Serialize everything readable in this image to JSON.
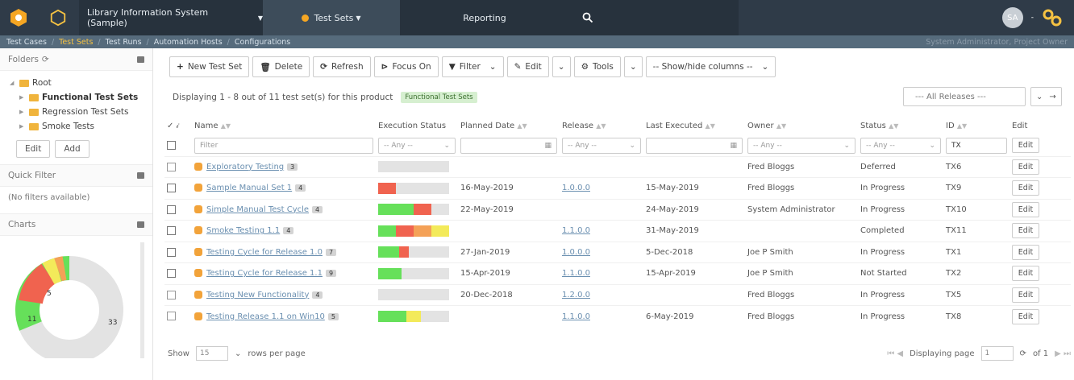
{
  "topnav": {
    "project": "Library Information System (Sample)",
    "test_sets_menu": "Test Sets",
    "reporting": "Reporting",
    "avatar_initials": "SA",
    "accent_color": "#f5a623"
  },
  "subnav": {
    "items": [
      "Test Cases",
      "Test Sets",
      "Test Runs",
      "Automation Hosts",
      "Configurations"
    ],
    "right_text": "System Administrator, Project Owner"
  },
  "sidebar": {
    "folders_title": "Folders",
    "tree": {
      "root": "Root",
      "children": [
        "Functional Test Sets",
        "Regression Test Sets",
        "Smoke Tests"
      ]
    },
    "edit_label": "Edit",
    "add_label": "Add",
    "quick_filter_title": "Quick Filter",
    "no_filters": "(No filters available)",
    "charts_title": "Charts",
    "chart": {
      "labels": [
        "5",
        "11",
        "33"
      ]
    }
  },
  "toolbar": {
    "new_test_set": "New Test Set",
    "delete": "Delete",
    "refresh": "Refresh",
    "focus_on": "Focus On",
    "filter": "Filter",
    "edit": "Edit",
    "tools": "Tools",
    "show_hide": "-- Show/hide columns --"
  },
  "summary": {
    "displaying": "Displaying 1 - 8 out of 11 test set(s) for this product",
    "folder_badge": "Functional Test Sets",
    "releases_select": "--- All Releases ---"
  },
  "columns": [
    "Name",
    "Execution Status",
    "Planned Date",
    "Release",
    "Last Executed",
    "Owner",
    "Status",
    "ID",
    "Edit"
  ],
  "filters": {
    "name_placeholder": "Filter",
    "any": "-- Any --",
    "id_prefix": "TX"
  },
  "rows": [
    {
      "name": "Exploratory Testing",
      "count": "3",
      "planned": "",
      "planned_late": false,
      "release": "",
      "last": "",
      "owner": "Fred Bloggs",
      "status": "Deferred",
      "id": "TX6",
      "exec": [],
      "checkbox_style": "light"
    },
    {
      "name": "Sample Manual Set 1",
      "count": "4",
      "planned": "16-May-2019",
      "planned_late": true,
      "release": "1.0.0.0",
      "last": "15-May-2019",
      "owner": "Fred Bloggs",
      "status": "In Progress",
      "id": "TX9",
      "exec": [
        {
          "color": "#f0634f",
          "pct": 25
        }
      ],
      "checkbox_style": "dark"
    },
    {
      "name": "Simple Manual Test Cycle",
      "count": "4",
      "planned": "22-May-2019",
      "planned_late": true,
      "release": "",
      "last": "24-May-2019",
      "owner": "System Administrator",
      "status": "In Progress",
      "id": "TX10",
      "exec": [
        {
          "color": "#66e05a",
          "pct": 50
        },
        {
          "color": "#f0634f",
          "pct": 25
        }
      ],
      "checkbox_style": "dark"
    },
    {
      "name": "Smoke Testing 1.1",
      "count": "4",
      "planned": "",
      "planned_late": false,
      "release": "1.1.0.0",
      "last": "31-May-2019",
      "owner": "",
      "status": "Completed",
      "id": "TX11",
      "exec": [
        {
          "color": "#66e05a",
          "pct": 25
        },
        {
          "color": "#f0634f",
          "pct": 25
        },
        {
          "color": "#f4a157",
          "pct": 25
        },
        {
          "color": "#f3ea5a",
          "pct": 25
        }
      ],
      "checkbox_style": "dark"
    },
    {
      "name": "Testing Cycle for Release 1.0",
      "count": "7",
      "planned": "27-Jan-2019",
      "planned_late": true,
      "release": "1.0.0.0",
      "last": "5-Dec-2018",
      "owner": "Joe P Smith",
      "status": "In Progress",
      "id": "TX1",
      "exec": [
        {
          "color": "#66e05a",
          "pct": 29
        },
        {
          "color": "#f0634f",
          "pct": 14
        }
      ],
      "checkbox_style": "dark"
    },
    {
      "name": "Testing Cycle for Release 1.1",
      "count": "9",
      "planned": "15-Apr-2019",
      "planned_late": true,
      "release": "1.1.0.0",
      "last": "15-Apr-2019",
      "owner": "Joe P Smith",
      "status": "Not Started",
      "id": "TX2",
      "exec": [
        {
          "color": "#66e05a",
          "pct": 33
        }
      ],
      "checkbox_style": "dark"
    },
    {
      "name": "Testing New Functionality",
      "count": "4",
      "planned": "20-Dec-2018",
      "planned_late": true,
      "release": "1.2.0.0",
      "last": "",
      "owner": "Fred Bloggs",
      "status": "In Progress",
      "id": "TX5",
      "exec": [],
      "checkbox_style": "light"
    },
    {
      "name": "Testing Release 1.1 on Win10",
      "count": "5",
      "planned": "",
      "planned_late": false,
      "release": "1.1.0.0",
      "last": "6-May-2019",
      "owner": "Fred Bloggs",
      "status": "In Progress",
      "id": "TX8",
      "exec": [
        {
          "color": "#66e05a",
          "pct": 40
        },
        {
          "color": "#f3ea5a",
          "pct": 20
        }
      ],
      "checkbox_style": "light"
    }
  ],
  "edit_label": "Edit",
  "pager": {
    "show": "Show",
    "page_size": "15",
    "rows_per_page": "rows per page",
    "displaying_page": "Displaying page",
    "page": "1",
    "of": "of 1"
  }
}
